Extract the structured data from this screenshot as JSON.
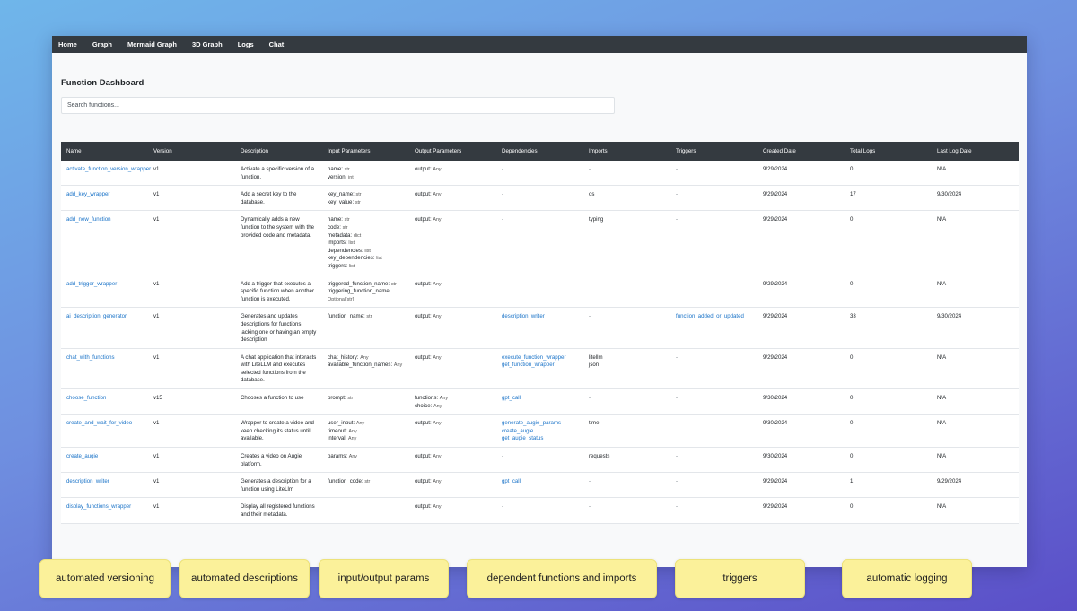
{
  "nav": [
    "Home",
    "Graph",
    "Mermaid Graph",
    "3D Graph",
    "Logs",
    "Chat"
  ],
  "page_title": "Function Dashboard",
  "search": {
    "placeholder": "Search functions..."
  },
  "columns": [
    "Name",
    "Version",
    "Description",
    "Input Parameters",
    "Output Parameters",
    "Dependencies",
    "Imports",
    "Triggers",
    "Created Date",
    "Total Logs",
    "Last Log Date"
  ],
  "rows": [
    {
      "name": "activate_function_version_wrapper",
      "version": "v1",
      "description": "Activate a specific version of a function.",
      "inputs": [
        [
          "name",
          "str"
        ],
        [
          "version",
          "int"
        ]
      ],
      "outputs": [
        [
          "output",
          "Any"
        ]
      ],
      "dependencies": [],
      "imports": [],
      "triggers": [],
      "created": "9/29/2024",
      "total_logs": "0",
      "last_log": "N/A"
    },
    {
      "name": "add_key_wrapper",
      "version": "v1",
      "description": "Add a secret key to the database.",
      "inputs": [
        [
          "key_name",
          "str"
        ],
        [
          "key_value",
          "str"
        ]
      ],
      "outputs": [
        [
          "output",
          "Any"
        ]
      ],
      "dependencies": [],
      "imports": [
        "os"
      ],
      "triggers": [],
      "created": "9/29/2024",
      "total_logs": "17",
      "last_log": "9/30/2024"
    },
    {
      "name": "add_new_function",
      "version": "v1",
      "description": "Dynamically adds a new function to the system with the provided code and metadata.",
      "inputs": [
        [
          "name",
          "str"
        ],
        [
          "code",
          "str"
        ],
        [
          "metadata",
          "dict"
        ],
        [
          "imports",
          "list"
        ],
        [
          "dependencies",
          "list"
        ],
        [
          "key_dependencies",
          "list"
        ],
        [
          "triggers",
          "list"
        ]
      ],
      "outputs": [
        [
          "output",
          "Any"
        ]
      ],
      "dependencies": [],
      "imports": [
        "typing"
      ],
      "triggers": [],
      "created": "9/29/2024",
      "total_logs": "0",
      "last_log": "N/A"
    },
    {
      "name": "add_trigger_wrapper",
      "version": "v1",
      "description": "Add a trigger that executes a specific function when another function is executed.",
      "inputs": [
        [
          "triggered_function_name",
          "str"
        ],
        [
          "triggering_function_name",
          "Optional[str]"
        ]
      ],
      "outputs": [
        [
          "output",
          "Any"
        ]
      ],
      "dependencies": [],
      "imports": [],
      "triggers": [],
      "created": "9/29/2024",
      "total_logs": "0",
      "last_log": "N/A"
    },
    {
      "name": "ai_description_generator",
      "version": "v1",
      "description": "Generates and updates descriptions for functions lacking one or having an empty description",
      "inputs": [
        [
          "function_name",
          "str"
        ]
      ],
      "outputs": [
        [
          "output",
          "Any"
        ]
      ],
      "dependencies": [
        "description_writer"
      ],
      "imports": [],
      "triggers": [
        "function_added_or_updated"
      ],
      "created": "9/29/2024",
      "total_logs": "33",
      "last_log": "9/30/2024"
    },
    {
      "name": "chat_with_functions",
      "version": "v1",
      "description": "A chat application that interacts with LiteLLM and executes selected functions from the database.",
      "inputs": [
        [
          "chat_history",
          "Any"
        ],
        [
          "available_function_names",
          "Any"
        ]
      ],
      "outputs": [
        [
          "output",
          "Any"
        ]
      ],
      "dependencies": [
        "execute_function_wrapper",
        "get_function_wrapper"
      ],
      "imports": [
        "litellm",
        "json"
      ],
      "triggers": [],
      "created": "9/29/2024",
      "total_logs": "0",
      "last_log": "N/A"
    },
    {
      "name": "choose_function",
      "version": "v15",
      "description": "Chooses a function to use",
      "inputs": [
        [
          "prompt",
          "str"
        ]
      ],
      "outputs": [
        [
          "functions",
          "Any"
        ],
        [
          "choice",
          "Any"
        ]
      ],
      "dependencies": [
        "gpt_call"
      ],
      "imports": [],
      "triggers": [],
      "created": "9/30/2024",
      "total_logs": "0",
      "last_log": "N/A"
    },
    {
      "name": "create_and_wait_for_video",
      "version": "v1",
      "description": "Wrapper to create a video and keep checking its status until available.",
      "inputs": [
        [
          "user_input",
          "Any"
        ],
        [
          "timeout",
          "Any"
        ],
        [
          "interval",
          "Any"
        ]
      ],
      "outputs": [
        [
          "output",
          "Any"
        ]
      ],
      "dependencies": [
        "generate_augie_params",
        "create_augie",
        "get_augie_status"
      ],
      "imports": [
        "time"
      ],
      "triggers": [],
      "created": "9/30/2024",
      "total_logs": "0",
      "last_log": "N/A"
    },
    {
      "name": "create_augie",
      "version": "v1",
      "description": "Creates a video on Augie platform.",
      "inputs": [
        [
          "params",
          "Any"
        ]
      ],
      "outputs": [
        [
          "output",
          "Any"
        ]
      ],
      "dependencies": [],
      "imports": [
        "requests"
      ],
      "triggers": [],
      "created": "9/30/2024",
      "total_logs": "0",
      "last_log": "N/A"
    },
    {
      "name": "description_writer",
      "version": "v1",
      "description": "Generates a description for a function using LiteLlm",
      "inputs": [
        [
          "function_code",
          "str"
        ]
      ],
      "outputs": [
        [
          "output",
          "Any"
        ]
      ],
      "dependencies": [
        "gpt_call"
      ],
      "imports": [],
      "triggers": [],
      "created": "9/29/2024",
      "total_logs": "1",
      "last_log": "9/29/2024"
    },
    {
      "name": "display_functions_wrapper",
      "version": "v1",
      "description": "Display all registered functions and their metadata.",
      "inputs": [],
      "outputs": [
        [
          "output",
          "Any"
        ]
      ],
      "dependencies": [],
      "imports": [],
      "triggers": [],
      "created": "9/29/2024",
      "total_logs": "0",
      "last_log": "N/A"
    }
  ],
  "empty_marker": "-",
  "features": [
    "automated versioning",
    "automated descriptions",
    "input/output params",
    "dependent functions and imports",
    "triggers",
    "automatic logging"
  ],
  "colors": {
    "navbar": "#343a40",
    "link": "#1a73c8",
    "badge": "#fbf19a"
  }
}
